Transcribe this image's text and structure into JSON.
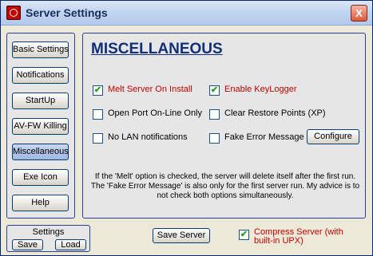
{
  "window": {
    "title": "Server Settings",
    "close_label": "X"
  },
  "sidebar": {
    "items": [
      {
        "label": "Basic Settings",
        "active": false
      },
      {
        "label": "Notifications",
        "active": false
      },
      {
        "label": "StartUp",
        "active": false
      },
      {
        "label": "AV-FW Killing",
        "active": false
      },
      {
        "label": "Miscellaneous",
        "active": true
      },
      {
        "label": "Exe Icon",
        "active": false
      },
      {
        "label": "Help",
        "active": false
      }
    ]
  },
  "settings_box": {
    "title": "Settings",
    "save_label": "Save",
    "load_label": "Load"
  },
  "main": {
    "title": "MISCELLANEOUS",
    "options": [
      {
        "label": "Melt Server On Install",
        "checked": true,
        "color": "#c00000"
      },
      {
        "label": "Enable KeyLogger",
        "checked": true,
        "color": "#c00000"
      },
      {
        "label": "Open Port On-Line Only",
        "checked": false,
        "color": "#000000"
      },
      {
        "label": "Clear Restore Points (XP)",
        "checked": false,
        "color": "#000000"
      },
      {
        "label": "No LAN notifications",
        "checked": false,
        "color": "#000000"
      },
      {
        "label": "Fake Error Message",
        "checked": false,
        "color": "#000000"
      }
    ],
    "configure_label": "Configure",
    "info_text": "If the 'Melt' option is checked, the server will delete itself after the first run. The 'Fake Error Message' is also only for the first server run. My advice is to not check both options simultaneously."
  },
  "footer": {
    "save_server_label": "Save Server",
    "compress": {
      "label": "Compress Server (with built-in UPX)",
      "checked": true
    }
  }
}
